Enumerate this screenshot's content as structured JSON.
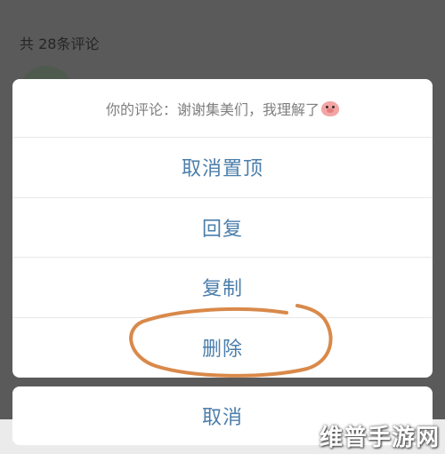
{
  "background": {
    "comment_count": "共 28条评论"
  },
  "sheet": {
    "title": "你的评论：谢谢集美们，我理解了",
    "title_emoji": "pig-face-icon",
    "items": [
      {
        "label": "取消置顶"
      },
      {
        "label": "回复"
      },
      {
        "label": "复制"
      },
      {
        "label": "删除"
      }
    ],
    "cancel_label": "取消"
  },
  "watermark": "维普手游网",
  "colors": {
    "action_text": "#4b7eab",
    "annotation_stroke": "#d9894a",
    "overlay": "#5a5a5a"
  }
}
